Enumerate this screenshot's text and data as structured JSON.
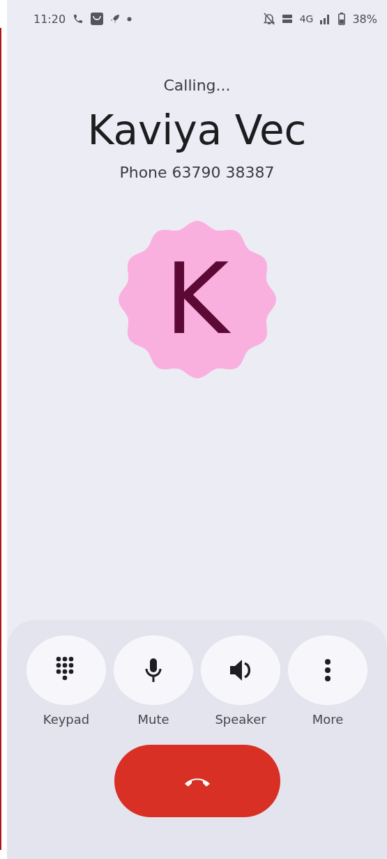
{
  "status_bar": {
    "time": "11:20",
    "network": "4G",
    "battery": "38%"
  },
  "call": {
    "status": "Calling...",
    "name": "Kaviya Vec",
    "number": "Phone 63790 38387",
    "initial": "K"
  },
  "actions": [
    {
      "kind": "keypad",
      "label": "Keypad"
    },
    {
      "kind": "mute",
      "label": "Mute"
    },
    {
      "kind": "speaker",
      "label": "Speaker"
    },
    {
      "kind": "more",
      "label": "More"
    }
  ]
}
